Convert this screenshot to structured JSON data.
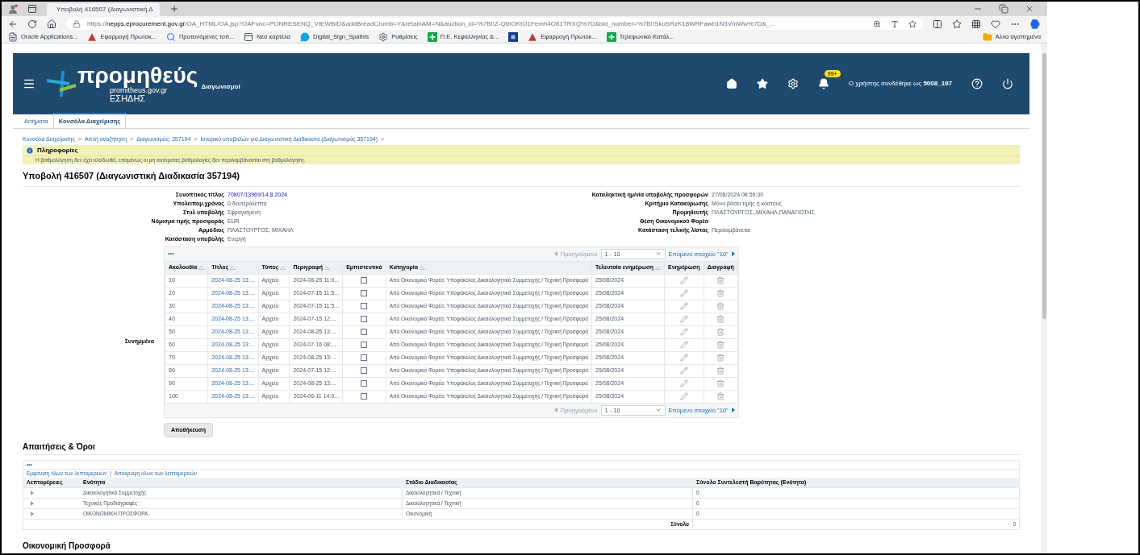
{
  "browser": {
    "tab_title": "Υποβολή 416507 (Διαγωνιστική Δ",
    "url_prefix": "https://",
    "url_host": "nepps.eprocurement.gov.gr",
    "url_rest": "/OA_HTML/OA.jsp?OAFunc=PONRESENQ_VIEWBID&addBreadCrumb=Y&retainAM=N&auction_id=%7B!!Z-QtbOKtO1Femh4O81TRXQ%7D&bid_number=%7B!!SkuSRzK18WRFawb1N3VmWw%7D&_...",
    "bookmarks": [
      {
        "kind": "page",
        "label": "Oracle Applications..."
      },
      {
        "kind": "app",
        "label": "Εφαρμογή Πρωτοκ..."
      },
      {
        "kind": "search",
        "label": "Προτεινόμενες τοπ..."
      },
      {
        "kind": "tab",
        "label": "Νέα καρτέλα"
      },
      {
        "kind": "chat",
        "label": "Digital_Sign_Spathis"
      },
      {
        "kind": "gear",
        "label": "Ρυθμίσεις"
      },
      {
        "kind": "sheet",
        "label": "Π.Ε. Κεφαλληνίας &..."
      },
      {
        "kind": "square"
      },
      {
        "kind": "app",
        "label": "Εφαρμογή Πρωτοκ..."
      },
      {
        "kind": "sheet",
        "label": "Τηλεφωνικό Κατάλ..."
      }
    ],
    "other_bookmarks": "Άλλα αγαπημένα"
  },
  "header": {
    "logo": "προμηθεύς",
    "logo_site": "promitheus.gov.gr",
    "logo_sub": "ΕΣΗΔΗΣ",
    "app_name": "Διαγωνισμοί",
    "notification_badge": "99+",
    "user_prefix": "Ο χρήστης συνδέθηκε ως",
    "user": "5008_197"
  },
  "tabs": [
    {
      "label": "Αιτήματα",
      "selected": false
    },
    {
      "label": "Κονσόλα Διαχείρισης",
      "selected": true
    }
  ],
  "breadcrumbs": [
    "Κονσόλα Διαχείρισης",
    "Απλή αναζήτηση",
    "Διαγωνισμός: 357194",
    "Ιστορικό υποβολών για Διαγωνιστική Διαδικασία (Διαγωνισμός 357194)"
  ],
  "breadcrumb_separator": ">",
  "info": {
    "title": "Πληροφορίες",
    "message": "Η βαθμολόγηση δεν έχει κλειδωθεί, επομένως οι μη αυτόματες βαθμολογίες δεν περιλαμβάνονται στη βαθμολόγηση."
  },
  "page_title": "Υποβολή 416507 (Διαγωνιστική Διαδικασία 357194)",
  "details_left": [
    {
      "label": "Συνοπτικός τίτλος",
      "value": "70807/13969/14.8.2024",
      "kind": "link"
    },
    {
      "label": "Υπολειπομ.χρόνος",
      "value": "0 δευτερόλεπτα",
      "kind": "text"
    },
    {
      "label": "Στυλ υποβολής",
      "value": "Σφραγισμένη",
      "kind": "text"
    },
    {
      "label": "Νόμισμα τιμής προσφοράς",
      "value": "EUR",
      "kind": "text"
    },
    {
      "label": "Αρμόδιος",
      "value": "ΠΛΑΣΤΟΥΡΓΟΣ, ΜΙΧΑΗΛ",
      "kind": "text"
    },
    {
      "label": "Κατάσταση υποβολής",
      "value": "Ενεργή",
      "kind": "text"
    }
  ],
  "details_right": [
    {
      "label": "Καταληκτική ημ/νία υποβολής προσφορών",
      "value": "27/08/2024 08:59:00"
    },
    {
      "label": "Κριτήριο Κατακύρωσης",
      "value": "Μόνο βάσει τιμής ή κόστους"
    },
    {
      "label": "Προμηθευτής",
      "value": "ΠΛΑΣΤΟΥΡΓΟΣ,,ΜΙΧΑΗΛ,ΠΑΝΑΓΙΩΤΗΣ"
    },
    {
      "label": "Θέση Οικονομικού Φορέα"
    },
    {
      "label": "Κατάσταση τελικής λίστας",
      "value": "Περιλαμβάνεται"
    }
  ],
  "attachments": {
    "label": "Συνημμένα",
    "more": "•••",
    "pager_top": {
      "previous": "Προηγούμενο",
      "range": "1 - 10",
      "next": "Επόμενο στοιχείο \"10\""
    },
    "pager_bottom": {
      "previous": "Προηγούμενο",
      "range": "1 - 10",
      "next": "Επόμενο στοιχείο \"10\""
    },
    "columns": [
      {
        "label": "Ακολουθία",
        "sortable": true
      },
      {
        "label": "Τίτλος",
        "sortable": true
      },
      {
        "label": "Τύπος",
        "sortable": true
      },
      {
        "label": "Περιγραφή",
        "sortable": true
      },
      {
        "label": "Εμπιστευτικό",
        "sortable": false
      },
      {
        "label": "Κατηγορία",
        "sortable": true
      },
      {
        "label": "Τελευταία ενημέρωση",
        "sortable": true
      },
      {
        "label": "Ενημέρωση",
        "sortable": false
      },
      {
        "label": "Διαγραφή",
        "sortable": false
      }
    ],
    "rows": [
      {
        "seq": "10",
        "title": "2024-08-25 13:...",
        "type": "Αρχείο",
        "description": "2024-08-25 11:0...",
        "confidential": false,
        "category": "Από Οικονομικό Φορέα: Υποφάκελος Δικαιολογητικά Συμμετοχής / Τεχνική Προσφορά",
        "updated": "25/08/2024"
      },
      {
        "seq": "20",
        "title": "2024-08-25 13:...",
        "type": "Αρχείο",
        "description": "2024-07-15 11:5...",
        "confidential": false,
        "category": "Από Οικονομικό Φορέα: Υποφάκελος Δικαιολογητικά Συμμετοχής / Τεχνική Προσφορά",
        "updated": "25/08/2024"
      },
      {
        "seq": "30",
        "title": "2024-08-25 13:...",
        "type": "Αρχείο",
        "description": "2024-07-15 11:5...",
        "confidential": false,
        "category": "Από Οικονομικό Φορέα: Υποφάκελος Δικαιολογητικά Συμμετοχής / Τεχνική Προσφορά",
        "updated": "25/08/2024"
      },
      {
        "seq": "40",
        "title": "2024-08-25 13:...",
        "type": "Αρχείο",
        "description": "2024-07-15 12:...",
        "confidential": false,
        "category": "Από Οικονομικό Φορέα: Υποφάκελος Δικαιολογητικά Συμμετοχής / Τεχνική Προσφορά",
        "updated": "25/08/2024"
      },
      {
        "seq": "50",
        "title": "2024-08-25 13:...",
        "type": "Αρχείο",
        "description": "2024-08-25 13:...",
        "confidential": false,
        "category": "Από Οικονομικό Φορέα: Υποφάκελος Δικαιολογητικά Συμμετοχής / Τεχνική Προσφορά",
        "updated": "25/08/2024"
      },
      {
        "seq": "60",
        "title": "2024-08-25 13:...",
        "type": "Αρχείο",
        "description": "2024-07-16 08:...",
        "confidential": false,
        "category": "Από Οικονομικό Φορέα: Υποφάκελος Δικαιολογητικά Συμμετοχής / Τεχνική Προσφορά",
        "updated": "25/08/2024"
      },
      {
        "seq": "70",
        "title": "2024-08-25 13:...",
        "type": "Αρχείο",
        "description": "2024-08-25 13:...",
        "confidential": false,
        "category": "Από Οικονομικό Φορέα: Υποφάκελος Δικαιολογητικά Συμμετοχής / Τεχνική Προσφορά",
        "updated": "25/08/2024"
      },
      {
        "seq": "80",
        "title": "2024-08-25 13:...",
        "type": "Αρχείο",
        "description": "2024-07-15 12:...",
        "confidential": false,
        "category": "Από Οικονομικό Φορέα: Υποφάκελος Δικαιολογητικά Συμμετοχής / Τεχνική Προσφορά",
        "updated": "25/08/2024"
      },
      {
        "seq": "90",
        "title": "2024-08-25 13:...",
        "type": "Αρχείο",
        "description": "2024-08-25 13:...",
        "confidential": false,
        "category": "Από Οικονομικό Φορέα: Υποφάκελος Δικαιολογητικά Συμμετοχής / Τεχνική Προσφορά",
        "updated": "25/08/2024"
      },
      {
        "seq": "100",
        "title": "2024-08-25 13:...",
        "type": "Αρχείο",
        "description": "2024-06-11 14:0...",
        "confidential": false,
        "category": "Από Οικονομικό Φορέα: Υποφάκελος Δικαιολογητικά Συμμετοχής / Τεχνική Προσφορά",
        "updated": "25/08/2024"
      }
    ]
  },
  "save_button": "Αποθήκευση",
  "requirements": {
    "heading": "Απαιτήσεις & Όροι",
    "more": "•••",
    "show_all": "Εμφάνιση όλων των λεπτομερειών",
    "links_separator": "|",
    "hide_all": "Απόκρυψη όλων των λεπτομερειών",
    "columns": [
      "Λεπτομέρειες",
      "Ενότητα",
      "Στάδιο Διαδικασίας",
      "Σύνολο Συντελεστή Βαρύτητας (Ενότητα)"
    ],
    "rows": [
      {
        "section": "Δικαιολογητικά Συμμετοχής",
        "stage": "Δικαιολογητικά / Τεχνική",
        "weight": "0",
        "expanded": false
      },
      {
        "section": "Τεχνικές Προδιαγραφές",
        "stage": "Δικαιολογητικά / Τεχνική",
        "weight": "0",
        "expanded": false
      },
      {
        "section": "ΟΙΚΟΝΟΜΙΚΗ ΠΡΟΣΦΟΡΑ",
        "stage": "Οικονομική",
        "weight": "0",
        "expanded": false
      }
    ],
    "total_label": "Σύνολο",
    "total_value": "0"
  },
  "financial_heading": "Οικονομική Προσφορά"
}
